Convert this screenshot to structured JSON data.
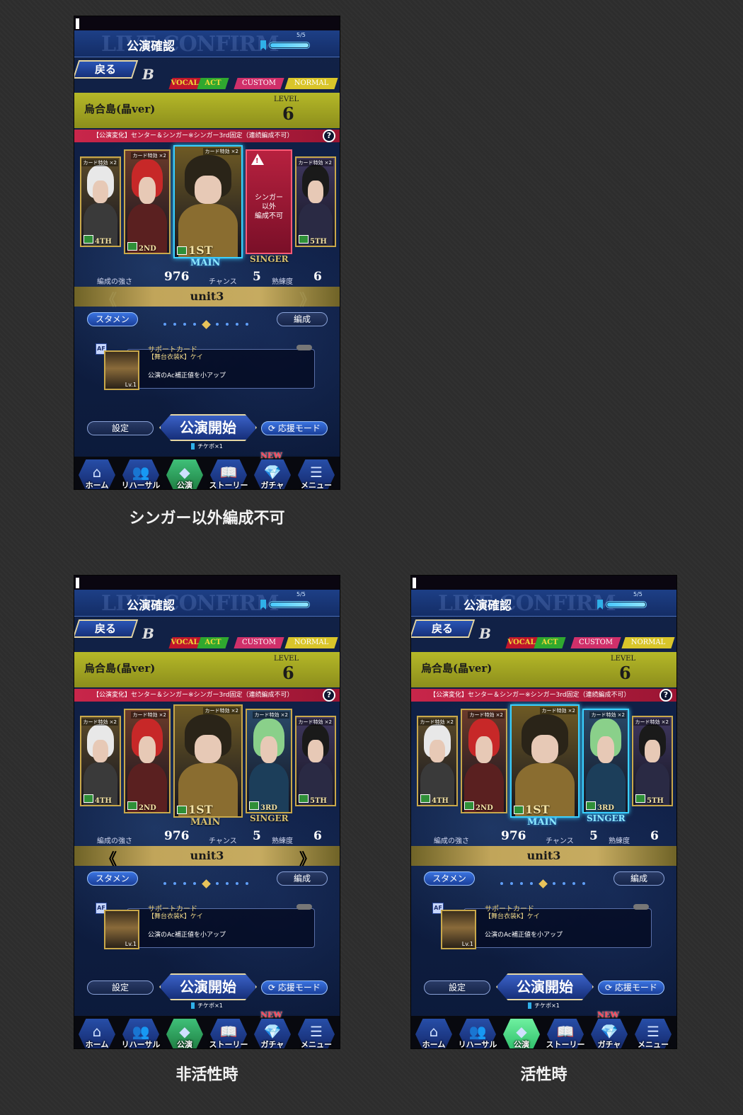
{
  "captions": [
    "シンガー以外編成不可",
    "非活性時",
    "活性時"
  ],
  "screen": {
    "title": "公演確認",
    "title_bg": "LIVE CONFIRM",
    "stamina_text": "5/5",
    "stamina_fraction": 1.0,
    "back_label": "戻る",
    "tags": [
      "VOCAL",
      "ACT",
      "CUSTOM",
      "NORMAL"
    ],
    "song_name": "烏合島(晶ver)",
    "level_label": "LEVEL",
    "level": "6",
    "notice": "【公演変化】センター＆シンガー※シンガー3rd固定（連続編成不可）",
    "help": "?",
    "card_bonus": "カード特効 ×2",
    "ranks": [
      "4TH",
      "2ND",
      "1ST",
      "3RD",
      "5TH"
    ],
    "role_main": "MAIN",
    "role_singer": "SINGER",
    "blocked_message": [
      "シンガー",
      "以外",
      "編成不可"
    ],
    "stat_strength_label": "編成の強さ",
    "stat_strength": "976",
    "stat_chance_label": "チャンス",
    "stat_chance": "5",
    "stat_skill_label": "熟練度",
    "stat_skill": "6",
    "unit_name": "unit3",
    "arrow_left": "《",
    "arrow_right": "》",
    "starter_label": "スタメン",
    "formation_label": "編成",
    "support_title": "サポートカード",
    "support_icon": "AF",
    "support_card_name": "【舞台衣装K】ケイ",
    "support_desc": "公演のAc補正値を小アップ",
    "support_level": "Lv.1",
    "settings_label": "設定",
    "start_label": "公演開始",
    "support_mode_label": "応援モード",
    "ticket": "チケボ×1",
    "new_badge": "NEW",
    "nav": [
      "ホーム",
      "リハーサル",
      "公演",
      "ストーリー",
      "ガチャ",
      "メニュー"
    ],
    "colors": {
      "vocal": "#c0162b",
      "act": "#2fa82f",
      "custom": "#d0306a",
      "normal": "#d9c52a",
      "song_bar": "#a9ab22",
      "notice": "#c8264a"
    }
  }
}
